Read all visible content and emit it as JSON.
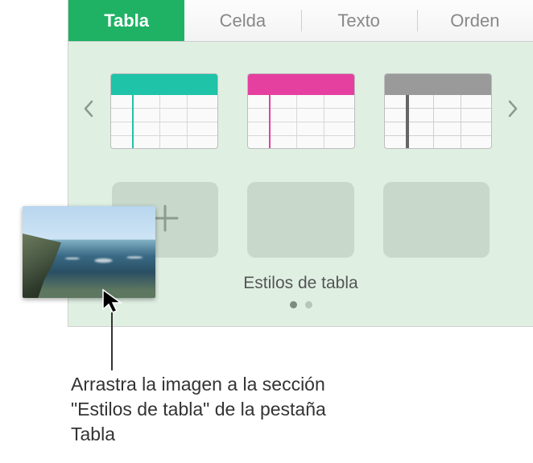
{
  "tabs": {
    "table": "Tabla",
    "cell": "Celda",
    "text": "Texto",
    "order": "Orden"
  },
  "styles": {
    "caption": "Estilos de tabla"
  },
  "callout": {
    "text": "Arrastra la imagen a la sección \"Estilos de tabla\" de la pestaña Tabla"
  }
}
